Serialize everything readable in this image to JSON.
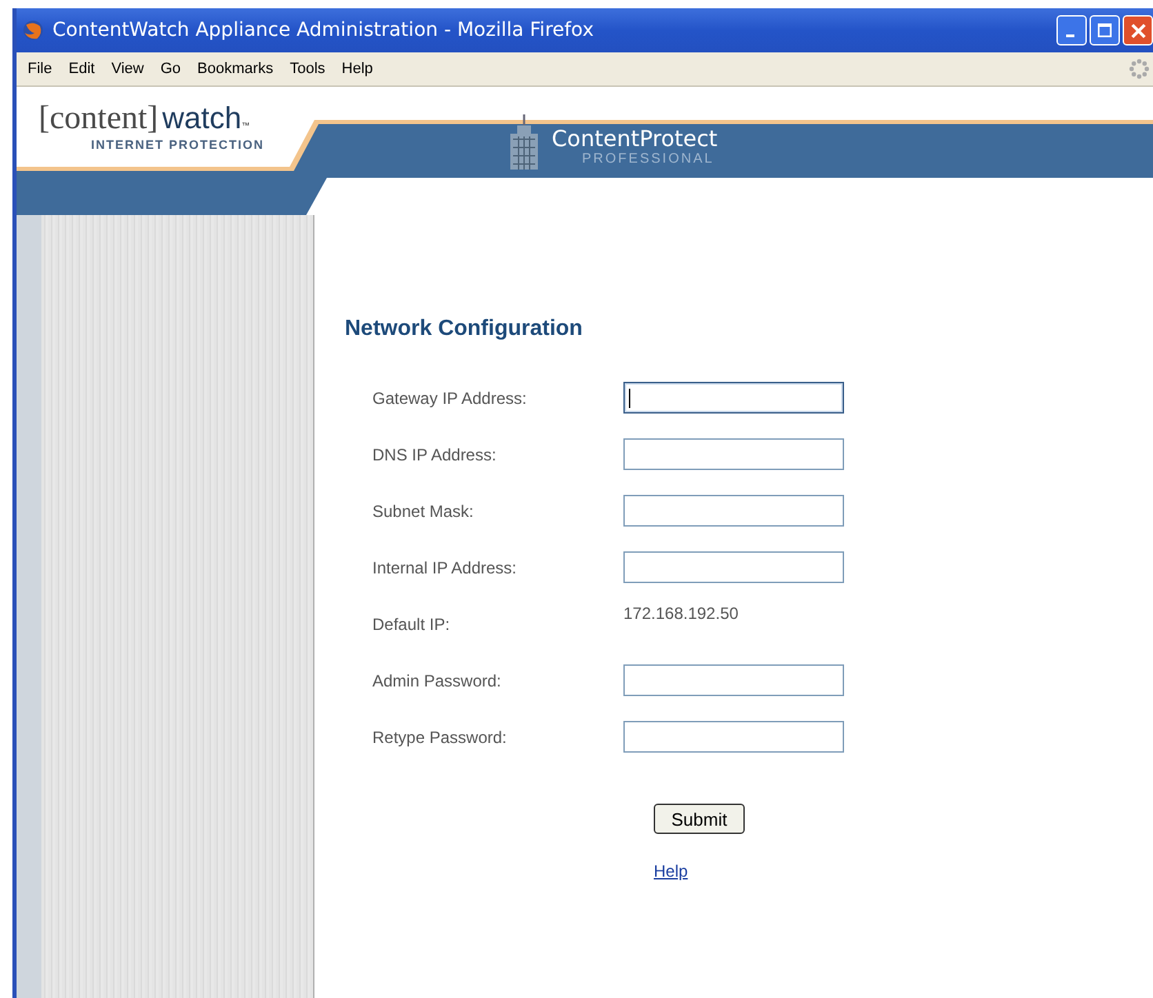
{
  "window": {
    "title": "ContentWatch Appliance Administration - Mozilla Firefox"
  },
  "menu": [
    "File",
    "Edit",
    "View",
    "Go",
    "Bookmarks",
    "Tools",
    "Help"
  ],
  "header": {
    "logo_left": "[content]",
    "logo_right": "watch",
    "logo_tm": "™",
    "logo_sub": "INTERNET PROTECTION",
    "product": "ContentProtect",
    "product_sub": "PROFESSIONAL"
  },
  "form": {
    "title": "Network Configuration",
    "rows": [
      {
        "kind": "input",
        "label": "Gateway IP Address:",
        "focused": true
      },
      {
        "kind": "input",
        "label": "DNS IP Address:",
        "focused": false
      },
      {
        "kind": "input",
        "label": "Subnet Mask:",
        "focused": false
      },
      {
        "kind": "input",
        "label": "Internal IP Address:",
        "focused": false
      },
      {
        "kind": "text",
        "label": "Default IP:",
        "value": "172.168.192.50"
      },
      {
        "kind": "input",
        "label": "Admin Password:",
        "focused": false
      },
      {
        "kind": "input",
        "label": "Retype Password:",
        "focused": false
      }
    ],
    "submit": "Submit",
    "help": "Help"
  }
}
